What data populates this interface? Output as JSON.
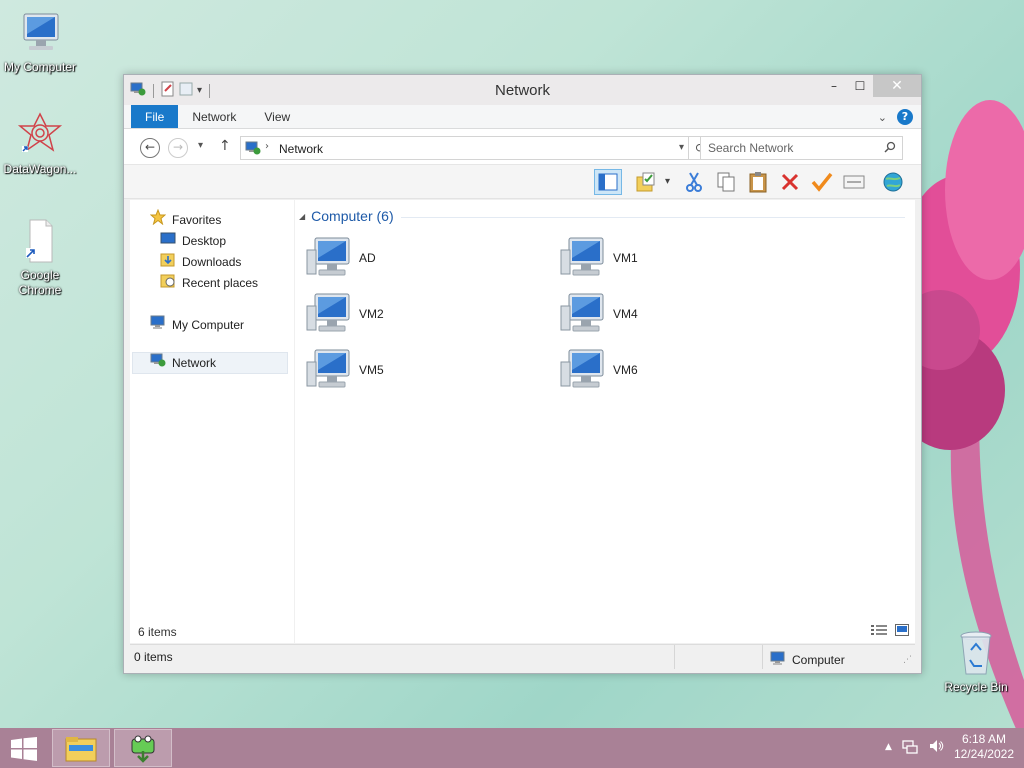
{
  "desktop": {
    "icons": [
      {
        "label": "My Computer",
        "icon": "my-computer-icon"
      },
      {
        "label": "DataWagon...",
        "icon": "datawagon-icon"
      },
      {
        "label": "Google Chrome",
        "icon": "google-chrome-shortcut-icon"
      },
      {
        "label": "Recycle Bin",
        "icon": "recycle-bin-icon"
      }
    ]
  },
  "window": {
    "title": "Network",
    "ribbon_tabs": [
      "File",
      "Network",
      "View"
    ],
    "caption": {
      "minimize": "–",
      "maximize": "☐",
      "close": "✕"
    },
    "address": {
      "path": "Network"
    },
    "search": {
      "placeholder": "Search Network"
    },
    "sidebar": {
      "favorites": "Favorites",
      "desktop": "Desktop",
      "downloads": "Downloads",
      "recent_places": "Recent places",
      "my_computer": "My Computer",
      "network": "Network"
    },
    "group": {
      "title": "Computer (6)"
    },
    "computers": [
      "AD",
      "VM1",
      "VM2",
      "VM4",
      "VM5",
      "VM6"
    ],
    "items_count": "6 items",
    "status": {
      "left": "0 items",
      "right": "Computer"
    }
  },
  "taskbar": {
    "time": "6:18 AM",
    "date": "12/24/2022"
  },
  "colors": {
    "accent": "#1979ca",
    "taskbar": "#a98196",
    "group_title": "#1e5aa8"
  }
}
